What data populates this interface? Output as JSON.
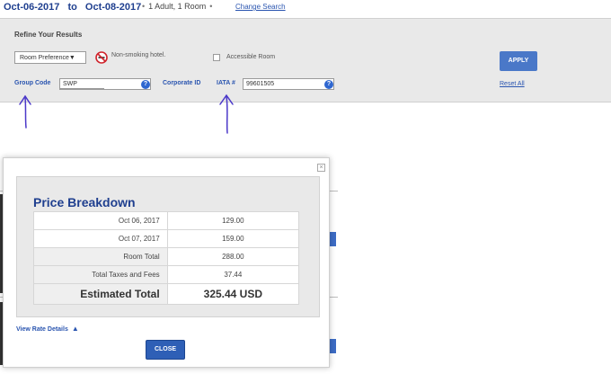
{
  "search": {
    "checkin": "Oct-06-2017",
    "to_label": "to",
    "checkout": "Oct-08-2017",
    "guests": "1 Adult, 1 Room",
    "change_link": "Change Search"
  },
  "refine": {
    "title": "Refine Your Results",
    "room_preference": "Room Preference",
    "non_smoking": "Non-smoking hotel.",
    "accessible": "Accessible Room",
    "apply": "APPLY",
    "reset": "Reset All",
    "group_code_label": "Group Code",
    "group_code_value": "SWP",
    "corporate_id_label": "Corporate ID",
    "iata_label": "IATA #",
    "iata_value": "99601505",
    "help_glyph": "?"
  },
  "colors": {
    "brand_blue": "#1f3f8f",
    "link_blue": "#2a55b0",
    "button_blue": "#4a78c8",
    "annotation_ink": "#4b38c9"
  },
  "modal": {
    "close_icon": "×",
    "title": "Price Breakdown",
    "rows": [
      {
        "label": "Oct 06, 2017",
        "value": "129.00"
      },
      {
        "label": "Oct 07, 2017",
        "value": "159.00"
      },
      {
        "label": "Room Total",
        "value": "288.00"
      },
      {
        "label": "Total Taxes and Fees",
        "value": "37.44"
      }
    ],
    "total_label": "Estimated Total",
    "total_value": "325.44 USD",
    "rate_details": "View Rate Details",
    "close_button": "CLOSE"
  }
}
